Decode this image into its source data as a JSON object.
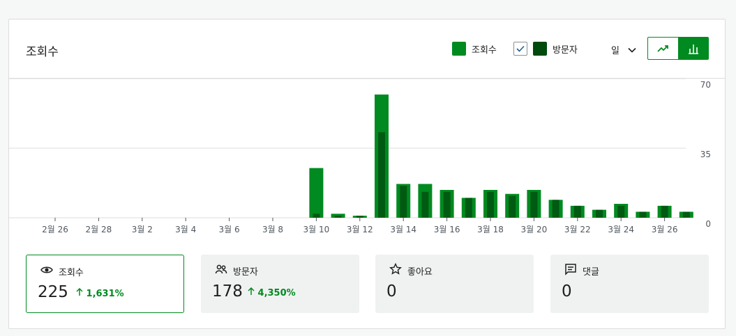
{
  "header": {
    "title": "조회수",
    "legend_views": "조회수",
    "legend_visitors": "방문자",
    "period": "일"
  },
  "colors": {
    "views": "#008a20",
    "visitors": "#005c12",
    "visitors_dark": "#004a0e"
  },
  "chart_data": {
    "type": "bar",
    "ylim": [
      0,
      70
    ],
    "yticks": [
      "70",
      "35",
      "0"
    ],
    "xtick_labels": [
      "2월 26",
      "2월 28",
      "3월 2",
      "3월 4",
      "3월 6",
      "3월 8",
      "3월 10",
      "3월 12",
      "3월 14",
      "3월 16",
      "3월 18",
      "3월 20",
      "3월 22",
      "3월 24",
      "3월 26"
    ],
    "series": [
      {
        "name": "조회수",
        "values": [
          0,
          0,
          0,
          0,
          0,
          0,
          0,
          0,
          0,
          0,
          0,
          0,
          25,
          2,
          1,
          62,
          17,
          17,
          14,
          10,
          14,
          12,
          14,
          9,
          6,
          4,
          7,
          3,
          6,
          3
        ]
      },
      {
        "name": "방문자",
        "values": [
          0,
          0,
          0,
          0,
          0,
          0,
          0,
          0,
          0,
          0,
          0,
          0,
          2,
          1,
          1,
          43,
          16,
          13,
          13,
          10,
          13,
          11,
          13,
          9,
          6,
          4,
          6,
          3,
          6,
          3
        ]
      }
    ]
  },
  "tiles": [
    {
      "label": "조회수",
      "value": "225",
      "delta": "1,631%"
    },
    {
      "label": "방문자",
      "value": "178",
      "delta": "4,350%"
    },
    {
      "label": "좋아요",
      "value": "0",
      "delta": ""
    },
    {
      "label": "댓글",
      "value": "0",
      "delta": ""
    }
  ]
}
